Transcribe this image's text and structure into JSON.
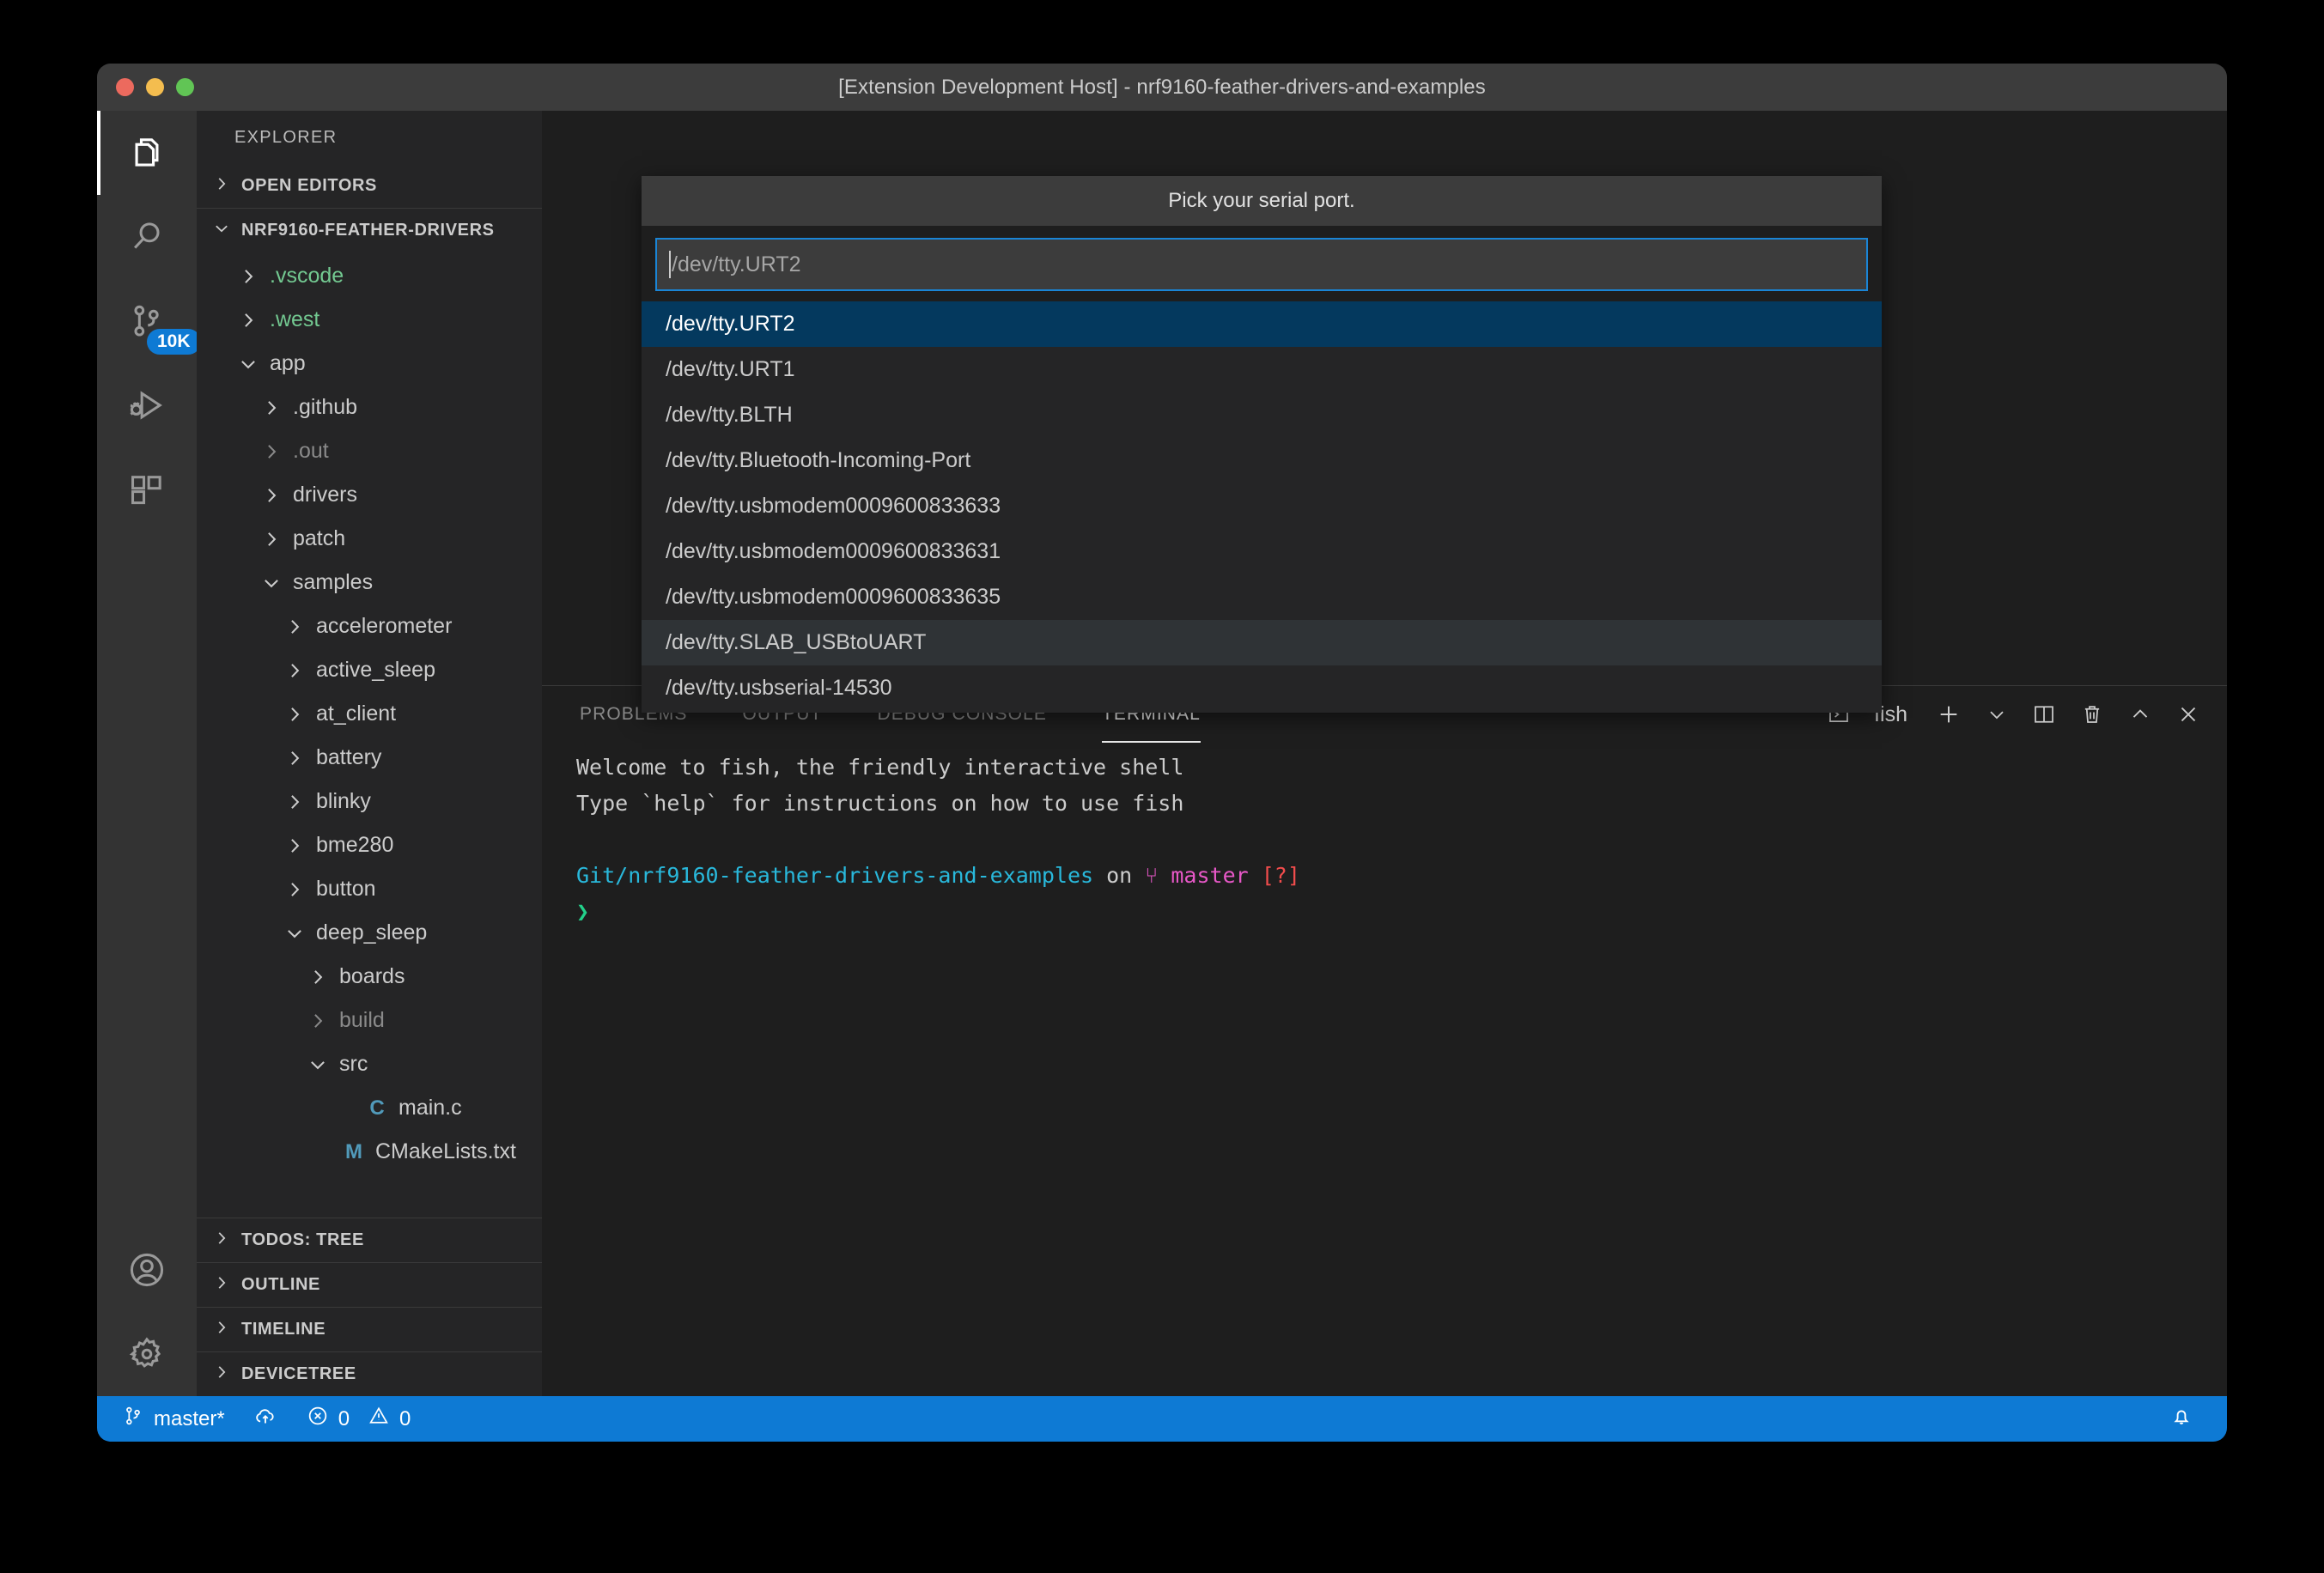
{
  "window": {
    "title": "[Extension Development Host] - nrf9160-feather-drivers-and-examples",
    "traffic_lights": [
      "close",
      "minimize",
      "zoom"
    ],
    "colors": {
      "titlebar_bg": "#3c3c3c",
      "accent_blue": "#0e7ad4",
      "selection_blue": "#04395e",
      "focus_border": "#1a85d6",
      "git_green": "#73c991",
      "file_icon_blue": "#519aba"
    }
  },
  "activity_bar": {
    "items": [
      {
        "name": "explorer",
        "icon": "files-icon",
        "active": true,
        "badge": ""
      },
      {
        "name": "search",
        "icon": "search-icon",
        "active": false,
        "badge": ""
      },
      {
        "name": "source-control",
        "icon": "source-control-icon",
        "active": false,
        "badge": "10K"
      },
      {
        "name": "run-and-debug",
        "icon": "run-debug-icon",
        "active": false,
        "badge": ""
      },
      {
        "name": "extensions",
        "icon": "extensions-icon",
        "active": false,
        "badge": ""
      }
    ],
    "bottom_items": [
      {
        "name": "accounts",
        "icon": "account-icon"
      },
      {
        "name": "manage",
        "icon": "gear-icon"
      }
    ]
  },
  "sidebar": {
    "title": "EXPLORER",
    "open_editors_label": "OPEN EDITORS",
    "root_label": "NRF9160-FEATHER-DRIVERS",
    "tree": [
      {
        "label": ".vscode",
        "depth": 1,
        "twisty": "collapsed",
        "style": "green",
        "icon": ""
      },
      {
        "label": ".west",
        "depth": 1,
        "twisty": "collapsed",
        "style": "green",
        "icon": ""
      },
      {
        "label": "app",
        "depth": 1,
        "twisty": "expanded",
        "style": "",
        "icon": ""
      },
      {
        "label": ".github",
        "depth": 2,
        "twisty": "collapsed",
        "style": "",
        "icon": ""
      },
      {
        "label": ".out",
        "depth": 2,
        "twisty": "collapsed",
        "style": "dim",
        "icon": ""
      },
      {
        "label": "drivers",
        "depth": 2,
        "twisty": "collapsed",
        "style": "",
        "icon": ""
      },
      {
        "label": "patch",
        "depth": 2,
        "twisty": "collapsed",
        "style": "",
        "icon": ""
      },
      {
        "label": "samples",
        "depth": 2,
        "twisty": "expanded",
        "style": "",
        "icon": ""
      },
      {
        "label": "accelerometer",
        "depth": 3,
        "twisty": "collapsed",
        "style": "",
        "icon": ""
      },
      {
        "label": "active_sleep",
        "depth": 3,
        "twisty": "collapsed",
        "style": "",
        "icon": ""
      },
      {
        "label": "at_client",
        "depth": 3,
        "twisty": "collapsed",
        "style": "",
        "icon": ""
      },
      {
        "label": "battery",
        "depth": 3,
        "twisty": "collapsed",
        "style": "",
        "icon": ""
      },
      {
        "label": "blinky",
        "depth": 3,
        "twisty": "collapsed",
        "style": "",
        "icon": ""
      },
      {
        "label": "bme280",
        "depth": 3,
        "twisty": "collapsed",
        "style": "",
        "icon": ""
      },
      {
        "label": "button",
        "depth": 3,
        "twisty": "collapsed",
        "style": "",
        "icon": ""
      },
      {
        "label": "deep_sleep",
        "depth": 3,
        "twisty": "expanded",
        "style": "",
        "icon": ""
      },
      {
        "label": "boards",
        "depth": 4,
        "twisty": "collapsed",
        "style": "",
        "icon": ""
      },
      {
        "label": "build",
        "depth": 4,
        "twisty": "collapsed",
        "style": "dim",
        "icon": ""
      },
      {
        "label": "src",
        "depth": 4,
        "twisty": "expanded",
        "style": "",
        "icon": ""
      },
      {
        "label": "main.c",
        "depth": 5,
        "twisty": "none",
        "style": "",
        "icon": "C"
      },
      {
        "label": "CMakeLists.txt",
        "depth": 4,
        "twisty": "none",
        "style": "",
        "icon": "M"
      }
    ],
    "bottom_sections": [
      {
        "label": "TODOS: TREE"
      },
      {
        "label": "OUTLINE"
      },
      {
        "label": "TIMELINE"
      },
      {
        "label": "DEVICETREE"
      }
    ]
  },
  "quick_pick": {
    "title": "Pick your serial port.",
    "input_value": "/dev/tty.URT2",
    "placeholder": "/dev/tty.URT2",
    "items": [
      {
        "label": "/dev/tty.URT2",
        "state": "selected"
      },
      {
        "label": "/dev/tty.URT1",
        "state": ""
      },
      {
        "label": "/dev/tty.BLTH",
        "state": ""
      },
      {
        "label": "/dev/tty.Bluetooth-Incoming-Port",
        "state": ""
      },
      {
        "label": "/dev/tty.usbmodem0009600833633",
        "state": ""
      },
      {
        "label": "/dev/tty.usbmodem0009600833631",
        "state": ""
      },
      {
        "label": "/dev/tty.usbmodem0009600833635",
        "state": ""
      },
      {
        "label": "/dev/tty.SLAB_USBtoUART",
        "state": "hover"
      },
      {
        "label": "/dev/tty.usbserial-14530",
        "state": ""
      }
    ]
  },
  "panel": {
    "tabs": [
      {
        "label": "PROBLEMS",
        "active": false
      },
      {
        "label": "OUTPUT",
        "active": false
      },
      {
        "label": "DEBUG CONSOLE",
        "active": false
      },
      {
        "label": "TERMINAL",
        "active": true
      }
    ],
    "actions": {
      "shell_label": "fish",
      "shell_icon": "terminal-icon",
      "new_terminal_icon": "plus-icon",
      "dropdown_icon": "chevron-down-icon",
      "split_icon": "split-editor-icon",
      "kill_icon": "trash-icon",
      "maximize_icon": "chevron-up-icon",
      "close_icon": "close-icon"
    },
    "terminal": {
      "line1": "Welcome to fish, the friendly interactive shell",
      "line2": "Type `help` for instructions on how to use fish",
      "prompt_path": "Git/nrf9160-feather-drivers-and-examples",
      "prompt_on": "on",
      "prompt_branch_glyph": "⑂",
      "prompt_branch": "master",
      "prompt_status": "[?]",
      "prompt_char": "❯"
    }
  },
  "status_bar": {
    "branch_icon": "source-control-icon",
    "branch": "master*",
    "sync_icon": "cloud-upload-icon",
    "error_icon": "error-icon",
    "error_count": "0",
    "warning_icon": "warning-icon",
    "warning_count": "0",
    "bell_icon": "bell-icon"
  }
}
